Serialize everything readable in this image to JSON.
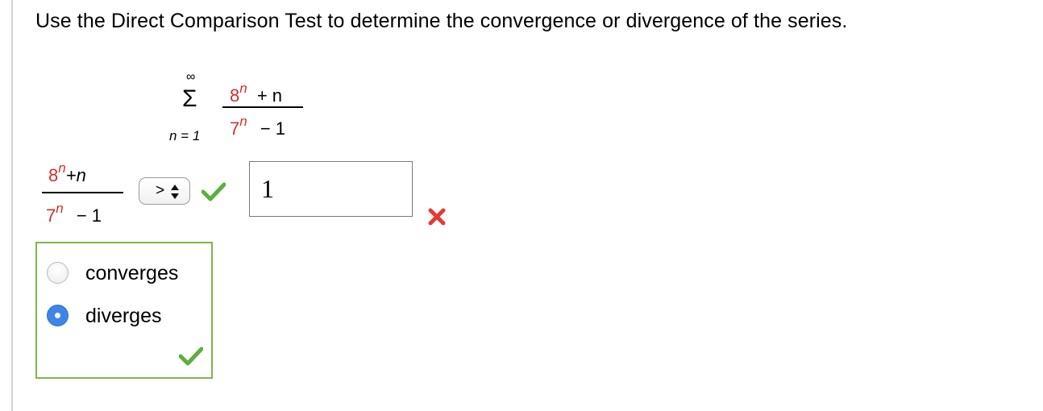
{
  "question": {
    "text": "Use the Direct Comparison Test to determine the convergence or divergence of the series."
  },
  "series": {
    "sum_upper": "∞",
    "sum_symbol": "Σ",
    "sum_lower": "n = 1",
    "numerator_base": "8",
    "numerator_exponent": "n",
    "numerator_rest": "+ n",
    "denominator_base": "7",
    "denominator_exponent": "n",
    "denominator_rest": "− 1"
  },
  "comparison": {
    "numerator_base": "8",
    "numerator_exponent": "n",
    "numerator_rest": "+n",
    "denominator_base": "7",
    "denominator_exponent": "n",
    "denominator_rest": "− 1",
    "selected_operator": ">",
    "operator_status": "correct",
    "answer_value": "1",
    "answer_status": "incorrect"
  },
  "choices": {
    "options": [
      {
        "label": "converges",
        "selected": false
      },
      {
        "label": "diverges",
        "selected": true
      }
    ],
    "status": "correct"
  },
  "colors": {
    "exponent_red": "#d32f2f",
    "correct_green": "#5fae3c",
    "incorrect_red": "#e53935",
    "group_border": "#7fb548",
    "radio_selected": "#3d86e8"
  }
}
